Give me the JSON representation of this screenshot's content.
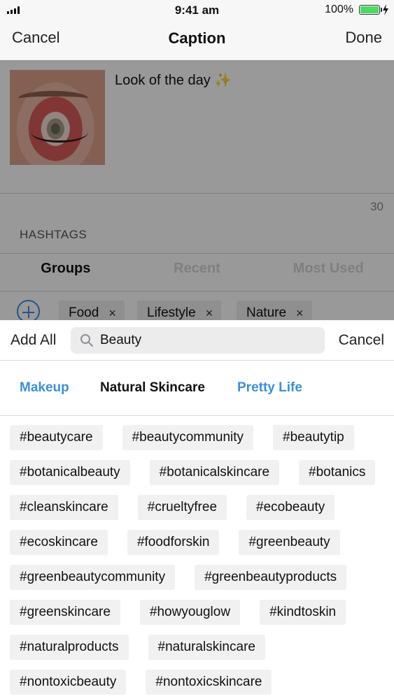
{
  "status_bar": {
    "time": "9:41 am",
    "battery": "100%"
  },
  "nav": {
    "cancel": "Cancel",
    "title": "Caption",
    "done": "Done"
  },
  "caption": {
    "text": "Look of the day",
    "emoji": "✨",
    "char_count": "30"
  },
  "hashtags": {
    "section_label": "HASHTAGS",
    "group_tabs": [
      "Groups",
      "Recent",
      "Most Used"
    ],
    "active_tab": "Groups",
    "chips": [
      "Food",
      "Lifestyle",
      "Nature"
    ],
    "chip_remove": "×"
  },
  "sheet": {
    "add_all": "Add All",
    "search_value": "Beauty",
    "cancel": "Cancel",
    "categories": [
      "Makeup",
      "Natural Skincare",
      "Pretty Life"
    ],
    "selected_category": "Natural Skincare",
    "tags": [
      [
        "#beautycare",
        "#beautycommunity",
        "#beautytip"
      ],
      [
        "#botanicalbeauty",
        "#botanicalskincare",
        "#botanics"
      ],
      [
        "#cleanskincare",
        "#crueltyfree",
        "#ecobeauty"
      ],
      [
        "#ecoskincare",
        "#foodforskin",
        "#greenbeauty"
      ],
      [
        "#greenbeautycommunity",
        "#greenbeautyproducts"
      ],
      [
        "#greenskincare",
        "#howyouglow",
        "#kindtoskin"
      ],
      [
        "#naturalproducts",
        "#naturalskincare"
      ],
      [
        "#nontoxicbeauty",
        "#nontoxicskincare"
      ]
    ]
  },
  "colors": {
    "accent_blue": "#3d8fd9",
    "battery_green": "#4cd964"
  }
}
